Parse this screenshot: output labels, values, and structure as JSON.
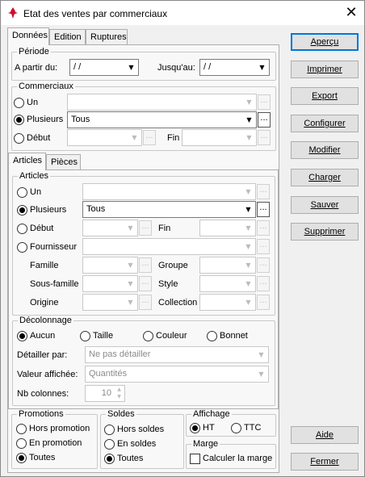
{
  "window": {
    "title": "Etat des ventes par commerciaux",
    "close_glyph": "✕",
    "app_icon": "app-logo-icon"
  },
  "tabs": [
    "Données",
    "Edition",
    "Ruptures"
  ],
  "periode": {
    "group": "Période",
    "from_label": "A partir du:",
    "from_value": " /  /",
    "to_label": "Jusqu'au:",
    "to_value": " /  /"
  },
  "commerciaux": {
    "group": "Commerciaux",
    "un": "Un",
    "plusieurs": "Plusieurs",
    "plusieurs_value": "Tous",
    "debut": "Début",
    "fin": "Fin",
    "selected": "plusieurs"
  },
  "subtabs": [
    "Articles",
    "Pièces"
  ],
  "articles": {
    "group": "Articles",
    "un": "Un",
    "plusieurs": "Plusieurs",
    "plusieurs_value": "Tous",
    "debut": "Début",
    "fin": "Fin",
    "fournisseur": "Fournisseur",
    "famille": "Famille",
    "groupe": "Groupe",
    "sous_famille": "Sous-famille",
    "style": "Style",
    "origine": "Origine",
    "collection": "Collection",
    "selected": "plusieurs"
  },
  "decolonnage": {
    "group": "Décolonnage",
    "options": [
      "Aucun",
      "Taille",
      "Couleur",
      "Bonnet"
    ],
    "selected": "Aucun",
    "detailler_label": "Détailler par:",
    "detailler_value": "Ne pas détailler",
    "valeur_label": "Valeur affichée:",
    "valeur_value": "Quantités",
    "nb_label": "Nb colonnes:",
    "nb_value": "10"
  },
  "promotions": {
    "group": "Promotions",
    "options": [
      "Hors promotion",
      "En promotion",
      "Toutes"
    ],
    "selected": "Toutes"
  },
  "soldes": {
    "group": "Soldes",
    "options": [
      "Hors soldes",
      "En soldes",
      "Toutes"
    ],
    "selected": "Toutes"
  },
  "affichage": {
    "group": "Affichage",
    "options": [
      "HT",
      "TTC"
    ],
    "selected": "HT"
  },
  "marge": {
    "group": "Marge",
    "checkbox": "Calculer la marge",
    "checked": false
  },
  "buttons": {
    "apercu": "Aperçu",
    "imprimer": "Imprimer",
    "export": "Export",
    "configurer": "Configurer",
    "modifier": "Modifier",
    "charger": "Charger",
    "sauver": "Sauver",
    "supprimer": "Supprimer",
    "aide": "Aide",
    "fermer": "Fermer"
  },
  "glyphs": {
    "dropdown": "▼",
    "dots": "...",
    "spin_up": "▲",
    "spin_down": "▼"
  }
}
